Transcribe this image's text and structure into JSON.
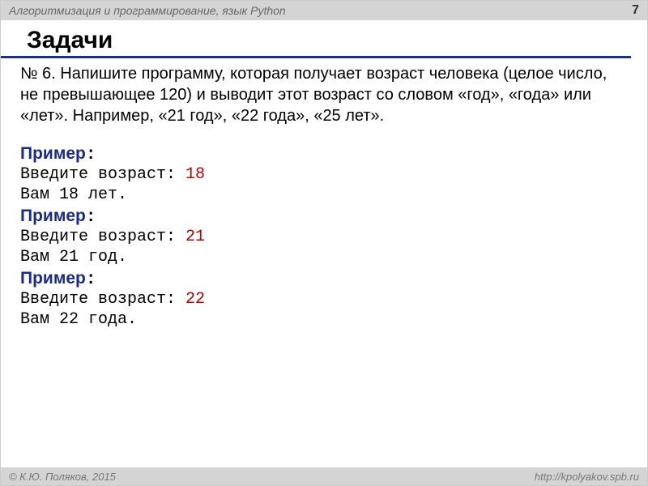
{
  "header": {
    "title": "Алгоритмизация и программирование, язык Python",
    "page_number": "7"
  },
  "main": {
    "heading": "Задачи",
    "task_text": "№ 6. Напишите программу, которая получает возраст человека (целое число, не превышающее 120) и выводит этот возраст со словом «год», «года» или «лет». Например, «21 год», «22 года», «25 лет».",
    "examples": [
      {
        "label": "Пример",
        "colon": ":",
        "prompt": "Введите возраст: ",
        "input": "18",
        "output": "Вам 18 лет."
      },
      {
        "label": "Пример",
        "colon": ":",
        "prompt": "Введите возраст: ",
        "input": "21",
        "output": "Вам 21 год."
      },
      {
        "label": "Пример",
        "colon": ":",
        "prompt": "Введите возраст: ",
        "input": "22",
        "output": "Вам 22 года."
      }
    ]
  },
  "footer": {
    "copyright": "© К.Ю. Поляков, 2015",
    "url": "http://kpolyakov.spb.ru"
  }
}
